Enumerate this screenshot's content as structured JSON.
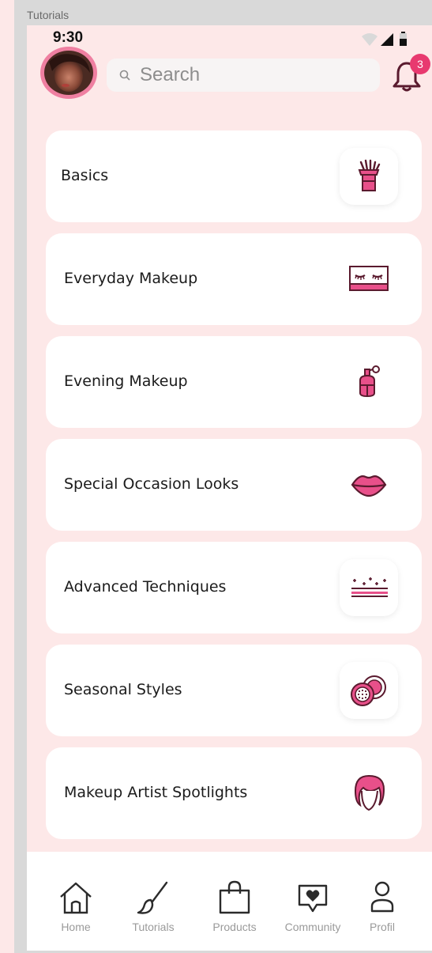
{
  "frame_label": "Tutorials",
  "status_bar": {
    "time": "9:30"
  },
  "header": {
    "search_placeholder": "Search",
    "notification_count": "3",
    "accent": "#e8396f"
  },
  "categories": [
    {
      "label": "Basics",
      "icon": "makeup-brush-icon"
    },
    {
      "label": "Everyday Makeup",
      "icon": "eyeshadow-palette-icon"
    },
    {
      "label": "Evening Makeup",
      "icon": "perfume-bottle-icon"
    },
    {
      "label": "Special Occasion Looks",
      "icon": "lips-icon"
    },
    {
      "label": "Advanced Techniques",
      "icon": "sparkles-icon"
    },
    {
      "label": "Seasonal Styles",
      "icon": "compact-powder-icon"
    },
    {
      "label": "Makeup Artist Spotlights",
      "icon": "hair-face-icon"
    }
  ],
  "bottom_nav": [
    {
      "label": "Home",
      "icon": "home-icon"
    },
    {
      "label": "Tutorials",
      "icon": "brush-icon"
    },
    {
      "label": "Products",
      "icon": "shopping-bag-icon"
    },
    {
      "label": "Community",
      "icon": "chat-heart-icon"
    },
    {
      "label": "Profil",
      "icon": "user-icon"
    }
  ],
  "colors": {
    "background": "#fde8e8",
    "card": "#ffffff",
    "icon_pink": "#e8508a",
    "icon_dark": "#5a1a2e"
  }
}
